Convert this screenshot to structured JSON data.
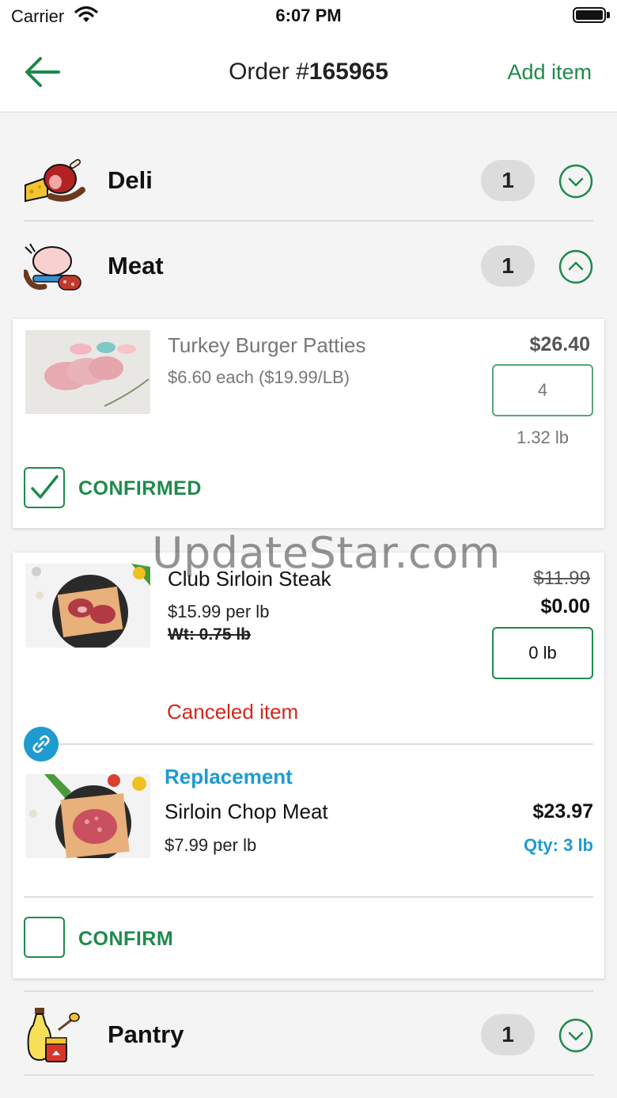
{
  "status_bar": {
    "carrier": "Carrier",
    "time": "6:07 PM"
  },
  "nav": {
    "title_prefix": "Order #",
    "order_number": "165965",
    "add_item": "Add item"
  },
  "categories": {
    "deli": {
      "name": "Deli",
      "count": "1"
    },
    "meat": {
      "name": "Meat",
      "count": "1"
    },
    "pantry": {
      "name": "Pantry",
      "count": "1"
    }
  },
  "items": {
    "turkey": {
      "name": "Turkey Burger Patties",
      "price_detail": "$6.60 each ($19.99/LB)",
      "total": "$26.40",
      "quantity": "4",
      "weight": "1.32 lb",
      "status": "CONFIRMED"
    },
    "steak": {
      "name": "Club Sirloin Steak",
      "unit_price": "$15.99 per lb",
      "weight": "Wt: 0.75 lb",
      "original_total": "$11.99",
      "total": "$0.00",
      "quantity": "0 lb",
      "status": "Canceled item"
    },
    "replacement": {
      "label": "Replacement",
      "name": "Sirloin Chop Meat",
      "unit_price": "$7.99 per lb",
      "total": "$23.97",
      "quantity": "Qty: 3 lb",
      "action": "CONFIRM"
    }
  },
  "watermark": "UpdateStar.com",
  "colors": {
    "accent_green": "#1e8a4b",
    "link_blue": "#1e9bd1",
    "cancel_red": "#d0281c",
    "muted_text": "#777777"
  }
}
